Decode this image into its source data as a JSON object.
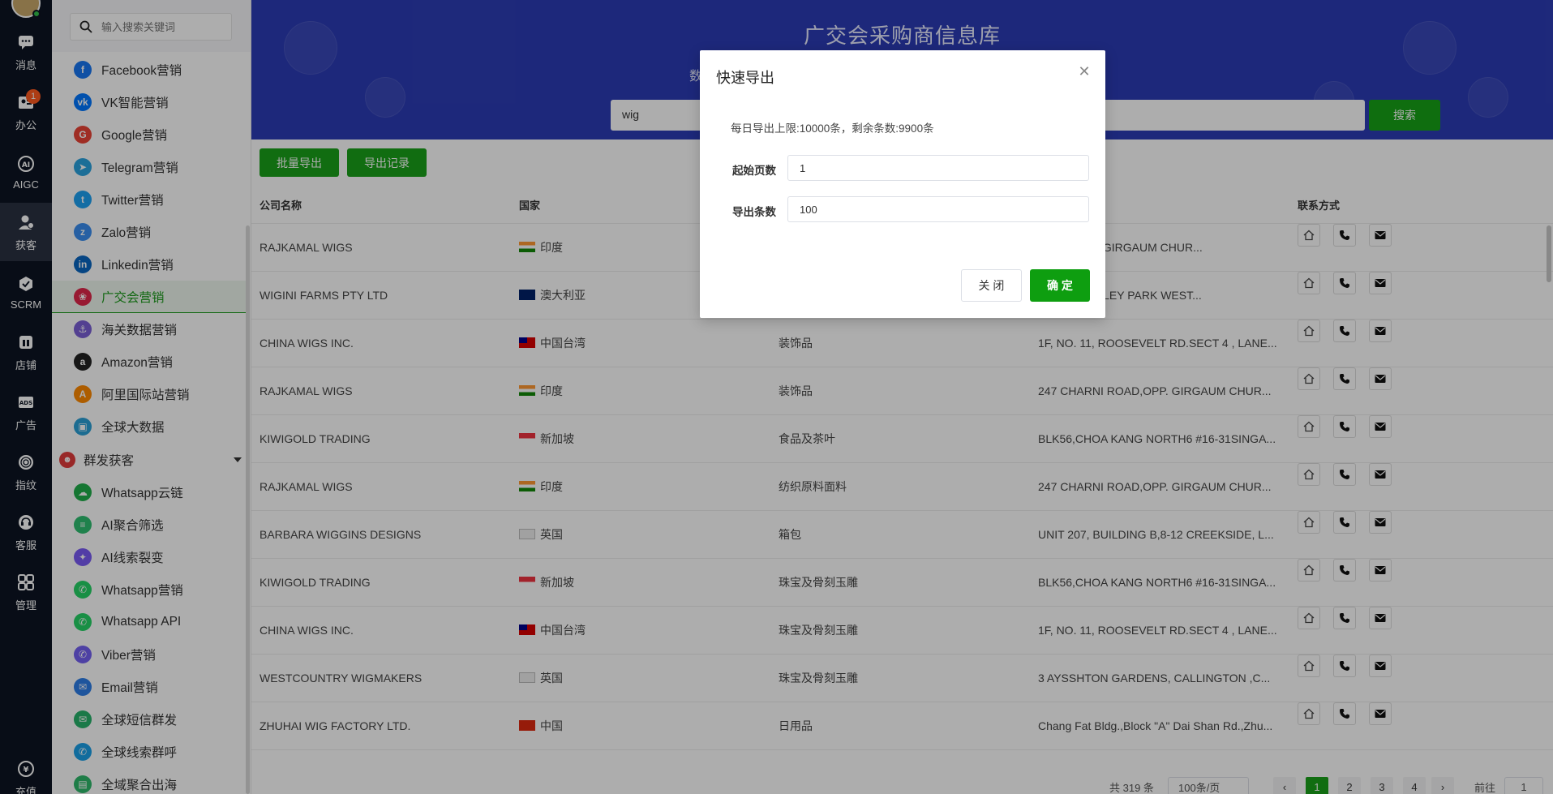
{
  "rail": {
    "items": [
      {
        "label": "消息",
        "icon": "chat-bubble-icon"
      },
      {
        "label": "办公",
        "icon": "id-card-icon",
        "badge": "1"
      },
      {
        "label": "AIGC",
        "icon": "ai-chip-icon"
      },
      {
        "label": "获客",
        "icon": "user-add-icon"
      },
      {
        "label": "SCRM",
        "icon": "hexagon-icon"
      },
      {
        "label": "店铺",
        "icon": "store-icon"
      },
      {
        "label": "广告",
        "icon": "ads-icon"
      },
      {
        "label": "指纹",
        "icon": "fingerprint-icon"
      },
      {
        "label": "客服",
        "icon": "headset-icon"
      },
      {
        "label": "管理",
        "icon": "grid-icon"
      },
      {
        "label": "充值",
        "icon": "yen-icon"
      }
    ]
  },
  "sidebar": {
    "search_placeholder": "输入搜索关键词",
    "items": [
      {
        "label": "Facebook营销",
        "color": "#1877f2",
        "glyph": "f"
      },
      {
        "label": "VK智能营销",
        "color": "#0077ff",
        "glyph": "vk"
      },
      {
        "label": "Google营销",
        "color": "#ea4335",
        "glyph": "G"
      },
      {
        "label": "Telegram营销",
        "color": "#2aa3df",
        "glyph": "➤"
      },
      {
        "label": "Twitter营销",
        "color": "#1da1f2",
        "glyph": "t"
      },
      {
        "label": "Zalo营销",
        "color": "#3a8ef0",
        "glyph": "z"
      },
      {
        "label": "Linkedin营销",
        "color": "#0a66c2",
        "glyph": "in"
      },
      {
        "label": "广交会营销",
        "color": "#e0274a",
        "glyph": "❀"
      },
      {
        "label": "海关数据营销",
        "color": "#7b5fd6",
        "glyph": "⚓"
      },
      {
        "label": "Amazon营销",
        "color": "#222222",
        "glyph": "a"
      },
      {
        "label": "阿里国际站营销",
        "color": "#ff8a00",
        "glyph": "A"
      },
      {
        "label": "全球大数据",
        "color": "#2a9fd6",
        "glyph": "▣"
      }
    ],
    "group_label": "群发获客",
    "group_items": [
      {
        "label": "Whatsapp云链",
        "color": "#1fae4a",
        "glyph": "☁"
      },
      {
        "label": "AI聚合筛选",
        "color": "#2fbf71",
        "glyph": "≡"
      },
      {
        "label": "AI线索裂变",
        "color": "#7a5af5",
        "glyph": "✦"
      },
      {
        "label": "Whatsapp营销",
        "color": "#25d366",
        "glyph": "✆"
      },
      {
        "label": "Whatsapp API",
        "color": "#25d366",
        "glyph": "✆"
      },
      {
        "label": "Viber营销",
        "color": "#7360f2",
        "glyph": "✆"
      },
      {
        "label": "Email营销",
        "color": "#2d7ee8",
        "glyph": "✉"
      },
      {
        "label": "全球短信群发",
        "color": "#27b36a",
        "glyph": "✉"
      },
      {
        "label": "全球线索群呼",
        "color": "#1aa0e8",
        "glyph": "✆"
      },
      {
        "label": "全域聚合出海",
        "color": "#2fb86b",
        "glyph": "▤"
      }
    ]
  },
  "hero": {
    "title": "广交会采购商信息库",
    "subtitle": "数",
    "search_value": "wig",
    "search_button": "搜索"
  },
  "toolbar": {
    "batch_export": "批量导出",
    "export_records": "导出记录"
  },
  "table": {
    "headers": [
      "公司名称",
      "国家",
      "",
      "",
      "联系方式"
    ],
    "rows": [
      {
        "company": "RAJKAMAL WIGS",
        "flag": "in",
        "country": "印度",
        "category": "",
        "address": "ROAD,OPP. GIRGAUM CHUR..."
      },
      {
        "company": "WIGINI FARMS PTY LTD",
        "flag": "au",
        "country": "澳大利亚",
        "category": "",
        "address": "PLACE DUDLEY PARK WEST..."
      },
      {
        "company": "CHINA WIGS INC.",
        "flag": "tw",
        "country": "中国台湾",
        "category": "装饰品",
        "address": "1F, NO. 11, ROOSEVELT RD.SECT 4 , LANE..."
      },
      {
        "company": "RAJKAMAL WIGS",
        "flag": "in",
        "country": "印度",
        "category": "装饰品",
        "address": "247 CHARNI ROAD,OPP. GIRGAUM CHUR..."
      },
      {
        "company": "KIWIGOLD TRADING",
        "flag": "sg",
        "country": "新加坡",
        "category": "食品及茶叶",
        "address": "BLK56,CHOA KANG NORTH6 #16-31SINGA..."
      },
      {
        "company": "RAJKAMAL WIGS",
        "flag": "in",
        "country": "印度",
        "category": "纺织原料面料",
        "address": "247 CHARNI ROAD,OPP. GIRGAUM CHUR..."
      },
      {
        "company": "BARBARA WIGGINS DESIGNS",
        "flag": "gb",
        "country": "英国",
        "category": "箱包",
        "address": "UNIT 207, BUILDING B,8-12 CREEKSIDE, L..."
      },
      {
        "company": "KIWIGOLD TRADING",
        "flag": "sg",
        "country": "新加坡",
        "category": "珠宝及骨刻玉雕",
        "address": "BLK56,CHOA KANG NORTH6 #16-31SINGA..."
      },
      {
        "company": "CHINA WIGS INC.",
        "flag": "tw",
        "country": "中国台湾",
        "category": "珠宝及骨刻玉雕",
        "address": "1F, NO. 11, ROOSEVELT RD.SECT 4 , LANE..."
      },
      {
        "company": "WESTCOUNTRY WIGMAKERS",
        "flag": "gb",
        "country": "英国",
        "category": "珠宝及骨刻玉雕",
        "address": "3 AYSSHTON GARDENS, CALLINGTON ,C..."
      },
      {
        "company": "ZHUHAI WIG FACTORY LTD.",
        "flag": "cn",
        "country": "中国",
        "category": "日用品",
        "address": "Chang Fat Bldg.,Block \"A\" Dai Shan Rd.,Zhu..."
      }
    ]
  },
  "pagination": {
    "total": "共 319 条",
    "page_size": "100条/页",
    "pages": [
      "1",
      "2",
      "3",
      "4"
    ],
    "current": "1",
    "goto_label": "前往",
    "goto_value": "1"
  },
  "modal": {
    "title": "快速导出",
    "info": "每日导出上限:10000条，剩余条数:9900条",
    "start_page_label": "起始页数",
    "start_page_value": "1",
    "count_label": "导出条数",
    "count_value": "100",
    "cancel": "关 闭",
    "confirm": "确 定"
  }
}
